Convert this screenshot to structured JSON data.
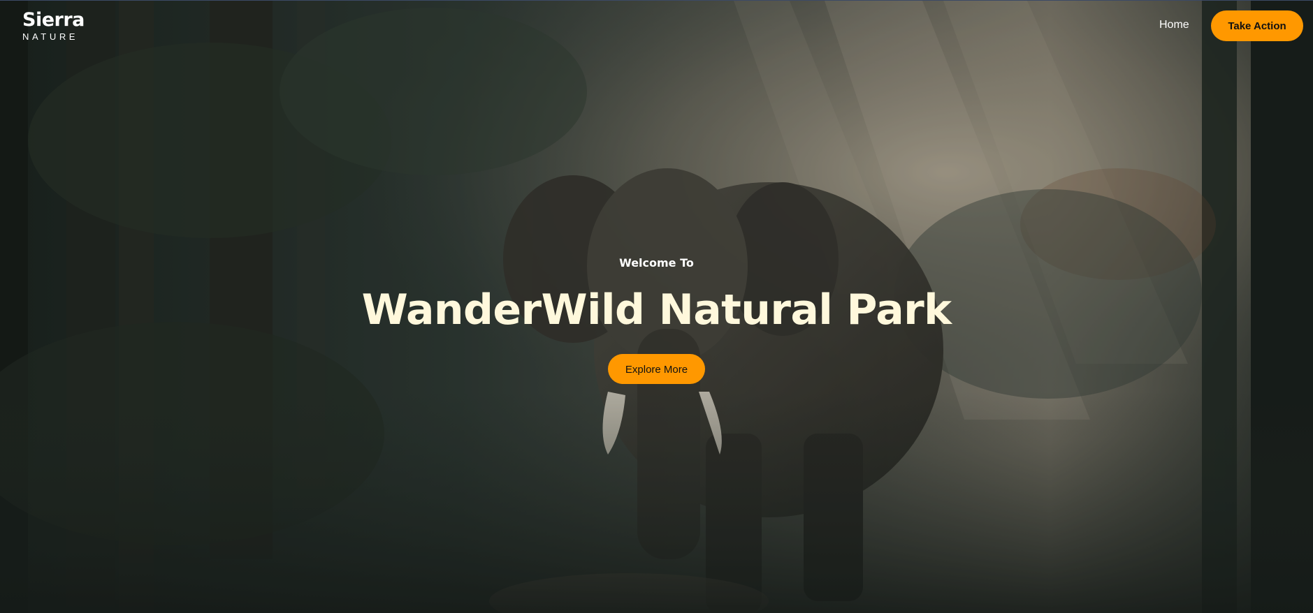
{
  "brand": {
    "name": "Sierra",
    "subtitle": "NATURE"
  },
  "nav": {
    "home_label": "Home",
    "cta_label": "Take Action"
  },
  "hero": {
    "eyebrow": "Welcome To",
    "title": "WanderWild Natural Park",
    "button_label": "Explore More",
    "image": "elephant-in-misty-forest"
  },
  "colors": {
    "accent": "#ff9800",
    "headline": "#fff8dc",
    "forest_dark": "#2b3430"
  }
}
